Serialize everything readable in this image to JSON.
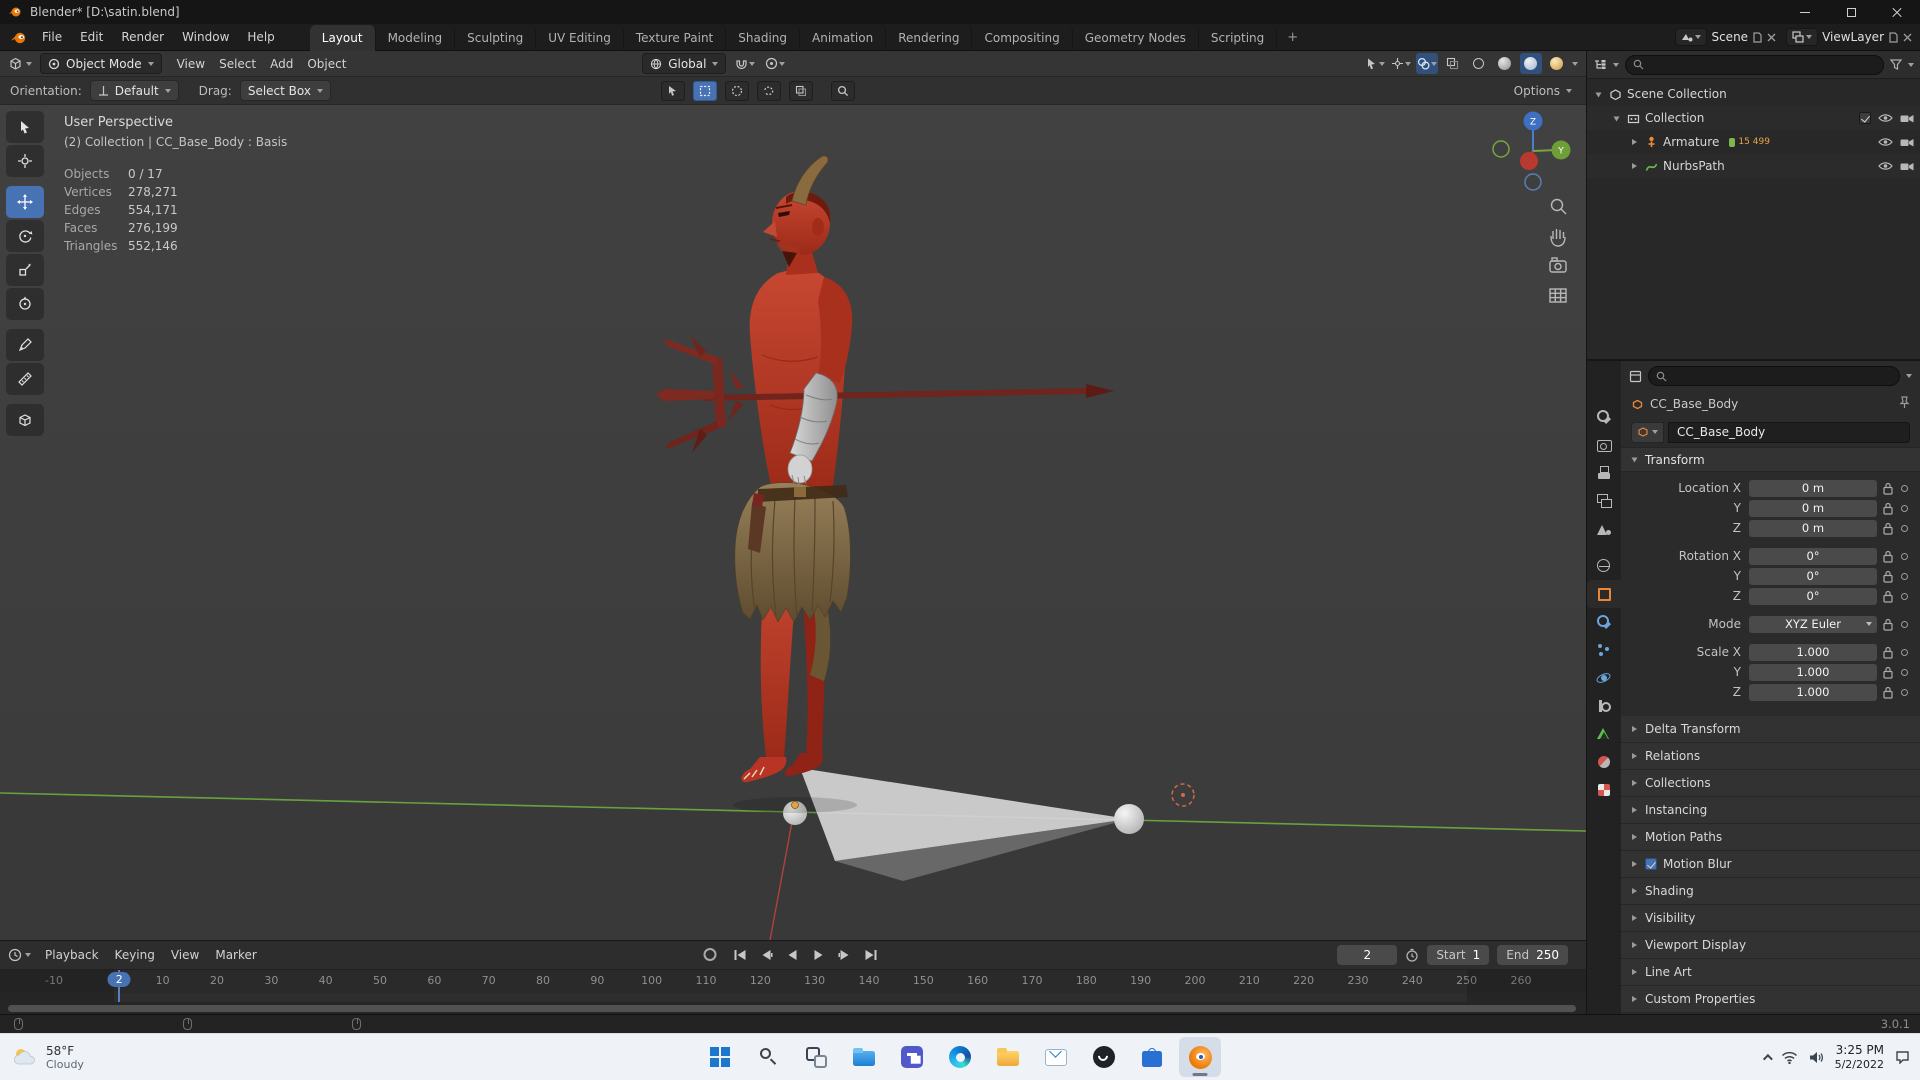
{
  "window": {
    "title": "Blender* [D:\\satin.blend]"
  },
  "menubar": {
    "menus": [
      "File",
      "Edit",
      "Render",
      "Window",
      "Help"
    ],
    "workspaces": [
      {
        "label": "Layout",
        "active": true
      },
      {
        "label": "Modeling"
      },
      {
        "label": "Sculpting"
      },
      {
        "label": "UV Editing"
      },
      {
        "label": "Texture Paint"
      },
      {
        "label": "Shading"
      },
      {
        "label": "Animation"
      },
      {
        "label": "Rendering"
      },
      {
        "label": "Compositing"
      },
      {
        "label": "Geometry Nodes"
      },
      {
        "label": "Scripting"
      }
    ],
    "add_workspace_label": "+",
    "scene_label": "Scene",
    "view_layer_label": "ViewLayer"
  },
  "viewport_header": {
    "mode_label": "Object Mode",
    "menus": [
      "View",
      "Select",
      "Add",
      "Object"
    ],
    "orientation_label": "Global",
    "options_label": "Options"
  },
  "tool_settings": {
    "orientation_label": "Orientation:",
    "orientation_value": "Default",
    "drag_label": "Drag:",
    "drag_value": "Select Box"
  },
  "viewport": {
    "perspective_label": "User Perspective",
    "context_label": "(2) Collection | CC_Base_Body : Basis",
    "stats": [
      {
        "label": "Objects",
        "value": "0 / 17"
      },
      {
        "label": "Vertices",
        "value": "278,271"
      },
      {
        "label": "Edges",
        "value": "554,171"
      },
      {
        "label": "Faces",
        "value": "276,199"
      },
      {
        "label": "Triangles",
        "value": "552,146"
      }
    ],
    "gizmo_axes": {
      "y": "Y",
      "z": "Z"
    }
  },
  "outliner": {
    "tree": [
      {
        "label": "Scene Collection",
        "level": 0,
        "type": "scene",
        "open": true
      },
      {
        "label": "Collection",
        "level": 1,
        "type": "collection",
        "open": true,
        "checkbox": true,
        "vis": true
      },
      {
        "label": "Armature",
        "level": 2,
        "type": "armature",
        "vis": true,
        "badges": [
          "15",
          "499"
        ]
      },
      {
        "label": "NurbsPath",
        "level": 2,
        "type": "curve",
        "vis": true
      }
    ]
  },
  "properties": {
    "tabs": [
      {
        "tab": "tool"
      },
      {
        "tab": "render"
      },
      {
        "tab": "output"
      },
      {
        "tab": "view-layer"
      },
      {
        "tab": "scene"
      },
      {
        "tab": "world"
      },
      {
        "tab": "object",
        "active": true
      },
      {
        "tab": "modifiers"
      },
      {
        "tab": "particles"
      },
      {
        "tab": "physics"
      },
      {
        "tab": "constraints"
      },
      {
        "tab": "data"
      },
      {
        "tab": "material"
      },
      {
        "tab": "texture"
      }
    ],
    "breadcrumb": "CC_Base_Body",
    "object_name": "CC_Base_Body",
    "transform_title": "Transform",
    "rows": [
      {
        "label": "Location X",
        "value": "0 m"
      },
      {
        "label": "Y",
        "value": "0 m"
      },
      {
        "label": "Z",
        "value": "0 m"
      },
      {
        "label": "Rotation X",
        "value": "0°",
        "gap": true
      },
      {
        "label": "Y",
        "value": "0°"
      },
      {
        "label": "Z",
        "value": "0°"
      },
      {
        "label": "Mode",
        "value": "XYZ Euler",
        "dropdown": true,
        "gap": true
      },
      {
        "label": "Scale X",
        "value": "1.000",
        "gap": true
      },
      {
        "label": "Y",
        "value": "1.000"
      },
      {
        "label": "Z",
        "value": "1.000"
      }
    ],
    "sections": [
      {
        "label": "Delta Transform"
      },
      {
        "label": "Relations"
      },
      {
        "label": "Collections"
      },
      {
        "label": "Instancing"
      },
      {
        "label": "Motion Paths"
      },
      {
        "label": "Motion Blur",
        "checkbox": true
      },
      {
        "label": "Shading"
      },
      {
        "label": "Visibility"
      },
      {
        "label": "Viewport Display"
      },
      {
        "label": "Line Art"
      },
      {
        "label": "Custom Properties"
      }
    ]
  },
  "timeline": {
    "menus": [
      "Playback",
      "Keying",
      "View",
      "Marker"
    ],
    "current_frame": "2",
    "playhead_frame": 2,
    "start_label": "Start",
    "start_value": "1",
    "end_label": "End",
    "end_value": "250",
    "ticks": [
      "-10",
      "10",
      "20",
      "30",
      "40",
      "50",
      "60",
      "70",
      "80",
      "90",
      "100",
      "110",
      "120",
      "130",
      "140",
      "150",
      "160",
      "170",
      "180",
      "190",
      "200",
      "210",
      "220",
      "230",
      "240",
      "250",
      "260"
    ]
  },
  "statusbar": {
    "version": "3.0.1"
  },
  "taskbar": {
    "weather_temp": "58°F",
    "weather_desc": "Cloudy",
    "apps": [
      {
        "app": "start"
      },
      {
        "app": "search"
      },
      {
        "app": "task-view"
      },
      {
        "app": "explorer"
      },
      {
        "app": "teams"
      },
      {
        "app": "edge"
      },
      {
        "app": "files"
      },
      {
        "app": "mail"
      },
      {
        "app": "xbox"
      },
      {
        "app": "store"
      },
      {
        "app": "blender",
        "active": true
      }
    ],
    "time": "3:25 PM",
    "date": "5/2/2022"
  }
}
